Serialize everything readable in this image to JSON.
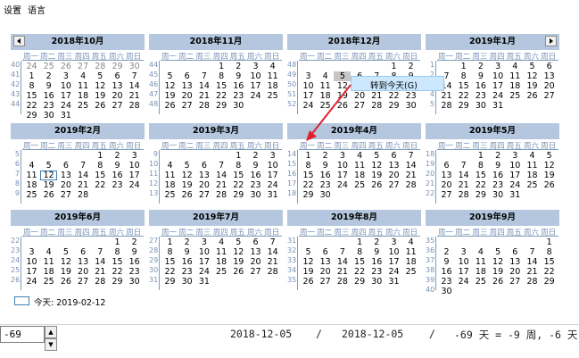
{
  "menu": [
    "设置",
    "语言"
  ],
  "weekdays": [
    "周一",
    "周二",
    "周三",
    "周四",
    "周五",
    "周六",
    "周日"
  ],
  "months": [
    {
      "title": "2018年10月",
      "weeks": [
        "40",
        "41",
        "42",
        "43",
        "44"
      ],
      "rows": [
        [
          "24",
          "25",
          "26",
          "27",
          "28",
          "29",
          "30"
        ],
        [
          "1",
          "2",
          "3",
          "4",
          "5",
          "6",
          "7"
        ],
        [
          "8",
          "9",
          "10",
          "11",
          "12",
          "13",
          "14"
        ],
        [
          "15",
          "16",
          "17",
          "18",
          "19",
          "20",
          "21"
        ],
        [
          "22",
          "23",
          "24",
          "25",
          "26",
          "27",
          "28"
        ],
        [
          "29",
          "30",
          "31",
          "",
          "",
          "",
          ""
        ]
      ],
      "prev_row_other": true
    },
    {
      "title": "2018年11月",
      "weeks": [
        "44",
        "45",
        "46",
        "47",
        "48"
      ],
      "rows": [
        [
          "",
          "",
          "",
          "1",
          "2",
          "3",
          "4"
        ],
        [
          "5",
          "6",
          "7",
          "8",
          "9",
          "10",
          "11"
        ],
        [
          "12",
          "13",
          "14",
          "15",
          "16",
          "17",
          "18"
        ],
        [
          "19",
          "20",
          "21",
          "22",
          "23",
          "24",
          "25"
        ],
        [
          "26",
          "27",
          "28",
          "29",
          "30",
          "",
          ""
        ]
      ]
    },
    {
      "title": "2018年12月",
      "weeks": [
        "48",
        "49",
        "50",
        "51",
        "52"
      ],
      "rows": [
        [
          "",
          "",
          "",
          "",
          "",
          "1",
          "2"
        ],
        [
          "3",
          "4",
          "5",
          "6",
          "7",
          "8",
          "9"
        ],
        [
          "10",
          "11",
          "12",
          "13",
          "14",
          "15",
          "16"
        ],
        [
          "17",
          "18",
          "19",
          "20",
          "21",
          "22",
          "23"
        ],
        [
          "24",
          "25",
          "26",
          "27",
          "28",
          "29",
          "30"
        ]
      ]
    },
    {
      "title": "2019年1月",
      "weeks": [
        "1",
        "2",
        "3",
        "4",
        "5"
      ],
      "rows": [
        [
          "",
          "1",
          "2",
          "3",
          "4",
          "5",
          "6"
        ],
        [
          "7",
          "8",
          "9",
          "10",
          "11",
          "12",
          "13"
        ],
        [
          "14",
          "15",
          "16",
          "17",
          "18",
          "19",
          "20"
        ],
        [
          "21",
          "22",
          "23",
          "24",
          "25",
          "26",
          "27"
        ],
        [
          "28",
          "29",
          "30",
          "31",
          "",
          "",
          ""
        ]
      ]
    },
    {
      "title": "2019年2月",
      "weeks": [
        "5",
        "6",
        "7",
        "8",
        "9"
      ],
      "rows": [
        [
          "",
          "",
          "",
          "",
          "1",
          "2",
          "3"
        ],
        [
          "4",
          "5",
          "6",
          "7",
          "8",
          "9",
          "10"
        ],
        [
          "11",
          "12",
          "13",
          "14",
          "15",
          "16",
          "17"
        ],
        [
          "18",
          "19",
          "20",
          "21",
          "22",
          "23",
          "24"
        ],
        [
          "25",
          "26",
          "27",
          "28",
          "",
          "",
          ""
        ]
      ]
    },
    {
      "title": "2019年3月",
      "weeks": [
        "9",
        "10",
        "11",
        "12",
        "13"
      ],
      "rows": [
        [
          "",
          "",
          "",
          "",
          "1",
          "2",
          "3"
        ],
        [
          "4",
          "5",
          "6",
          "7",
          "8",
          "9",
          "10"
        ],
        [
          "11",
          "12",
          "13",
          "14",
          "15",
          "16",
          "17"
        ],
        [
          "18",
          "19",
          "20",
          "21",
          "22",
          "23",
          "24"
        ],
        [
          "25",
          "26",
          "27",
          "28",
          "29",
          "30",
          "31"
        ]
      ]
    },
    {
      "title": "2019年4月",
      "weeks": [
        "14",
        "15",
        "16",
        "17",
        "18"
      ],
      "rows": [
        [
          "1",
          "2",
          "3",
          "4",
          "5",
          "6",
          "7"
        ],
        [
          "8",
          "9",
          "10",
          "11",
          "12",
          "13",
          "14"
        ],
        [
          "15",
          "16",
          "17",
          "18",
          "19",
          "20",
          "21"
        ],
        [
          "22",
          "23",
          "24",
          "25",
          "26",
          "27",
          "28"
        ],
        [
          "29",
          "30",
          "",
          "",
          "",
          "",
          ""
        ]
      ]
    },
    {
      "title": "2019年5月",
      "weeks": [
        "18",
        "19",
        "20",
        "21",
        "22"
      ],
      "rows": [
        [
          "",
          "",
          "1",
          "2",
          "3",
          "4",
          "5"
        ],
        [
          "6",
          "7",
          "8",
          "9",
          "10",
          "11",
          "12"
        ],
        [
          "13",
          "14",
          "15",
          "16",
          "17",
          "18",
          "19"
        ],
        [
          "20",
          "21",
          "22",
          "23",
          "24",
          "25",
          "26"
        ],
        [
          "27",
          "28",
          "29",
          "30",
          "31",
          "",
          ""
        ]
      ]
    },
    {
      "title": "2019年6月",
      "weeks": [
        "22",
        "23",
        "24",
        "25",
        "26"
      ],
      "rows": [
        [
          "",
          "",
          "",
          "",
          "",
          "1",
          "2"
        ],
        [
          "3",
          "4",
          "5",
          "6",
          "7",
          "8",
          "9"
        ],
        [
          "10",
          "11",
          "12",
          "13",
          "14",
          "15",
          "16"
        ],
        [
          "17",
          "18",
          "19",
          "20",
          "21",
          "22",
          "23"
        ],
        [
          "24",
          "25",
          "26",
          "27",
          "28",
          "29",
          "30"
        ]
      ]
    },
    {
      "title": "2019年7月",
      "weeks": [
        "27",
        "28",
        "29",
        "30",
        "31"
      ],
      "rows": [
        [
          "1",
          "2",
          "3",
          "4",
          "5",
          "6",
          "7"
        ],
        [
          "8",
          "9",
          "10",
          "11",
          "12",
          "13",
          "14"
        ],
        [
          "15",
          "16",
          "17",
          "18",
          "19",
          "20",
          "21"
        ],
        [
          "22",
          "23",
          "24",
          "25",
          "26",
          "27",
          "28"
        ],
        [
          "29",
          "30",
          "31",
          "",
          "",
          "",
          ""
        ]
      ]
    },
    {
      "title": "2019年8月",
      "weeks": [
        "31",
        "32",
        "33",
        "34",
        "35"
      ],
      "rows": [
        [
          "",
          "",
          "",
          "1",
          "2",
          "3",
          "4"
        ],
        [
          "5",
          "6",
          "7",
          "8",
          "9",
          "10",
          "11"
        ],
        [
          "12",
          "13",
          "14",
          "15",
          "16",
          "17",
          "18"
        ],
        [
          "19",
          "20",
          "21",
          "22",
          "23",
          "24",
          "25"
        ],
        [
          "26",
          "27",
          "28",
          "29",
          "30",
          "31",
          ""
        ]
      ]
    },
    {
      "title": "2019年9月",
      "weeks": [
        "35",
        "36",
        "37",
        "38",
        "39",
        "40"
      ],
      "rows": [
        [
          "",
          "",
          "",
          "",
          "",
          "",
          "1"
        ],
        [
          "2",
          "3",
          "4",
          "5",
          "6",
          "7",
          "8"
        ],
        [
          "9",
          "10",
          "11",
          "12",
          "13",
          "14",
          "15"
        ],
        [
          "16",
          "17",
          "18",
          "19",
          "20",
          "21",
          "22"
        ],
        [
          "23",
          "24",
          "25",
          "26",
          "27",
          "28",
          "29"
        ],
        [
          "30",
          "",
          "",
          "",
          "",
          "",
          ""
        ]
      ]
    }
  ],
  "today": {
    "label": "今天: 2019-02-12"
  },
  "context_menu": {
    "item": "转到今天(G)"
  },
  "bottom": {
    "offset_value": "-69",
    "date_from": "2018-12-05",
    "separator": "/",
    "date_to": "2018-12-05",
    "separator2": "/",
    "result": "-69 天 = -9 周, -6 天"
  },
  "colors": {
    "header_bg": "#b4c7de",
    "weekday_text": "#7891b5",
    "arrow": "#e0202a",
    "ctx_bg": "#cce8ff"
  }
}
